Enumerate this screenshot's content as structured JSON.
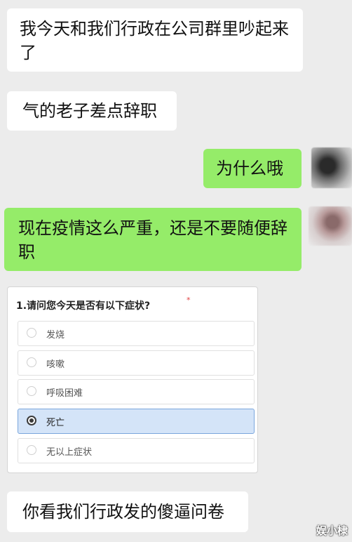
{
  "messages": [
    {
      "side": "left",
      "text": "我今天和我们行政在公司群里吵起来了"
    },
    {
      "side": "left",
      "text": "气的老子差点辞职"
    },
    {
      "side": "right",
      "text": "为什么哦"
    },
    {
      "side": "right",
      "text": "现在疫情这么严重，还是不要随便辞职"
    },
    {
      "side": "left",
      "text": "你看我们行政发的傻逼问卷"
    }
  ],
  "survey": {
    "question": "1.请问您今天是否有以下症状?",
    "required_mark": "*",
    "options": [
      {
        "label": "发烧",
        "selected": false
      },
      {
        "label": "咳嗽",
        "selected": false
      },
      {
        "label": "呼吸困难",
        "selected": false
      },
      {
        "label": "死亡",
        "selected": true
      },
      {
        "label": "无以上症状",
        "selected": false
      }
    ]
  },
  "watermark": "娱小棣",
  "colors": {
    "background": "#ececec",
    "incoming_bubble": "#ffffff",
    "outgoing_bubble": "#95ec69",
    "selected_option": "#d4e4f8"
  }
}
